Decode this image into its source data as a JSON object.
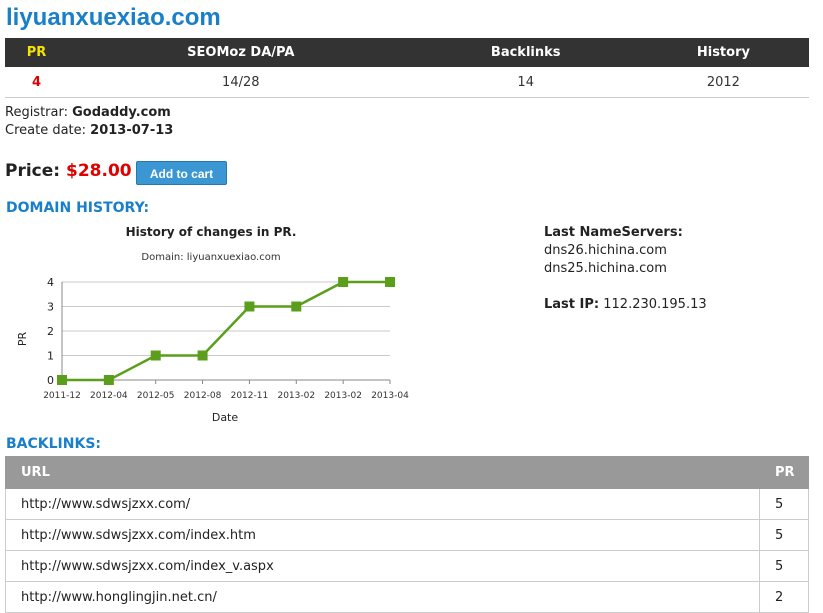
{
  "domain": "liyuanxuexiao.com",
  "stats": {
    "headers": [
      "PR",
      "SEOMoz DA/PA",
      "Backlinks",
      "History"
    ],
    "values": [
      "4",
      "14/28",
      "14",
      "2012"
    ]
  },
  "registrar_label": "Registrar:",
  "registrar": "Godaddy.com",
  "create_label": "Create date:",
  "create_date": "2013-07-13",
  "price_label": "Price:",
  "price": "$28.00",
  "add_to_cart": "Add to cart",
  "history_heading": "DOMAIN HISTORY:",
  "nameservers": {
    "label": "Last NameServers:",
    "servers": [
      "dns26.hichina.com",
      "dns25.hichina.com"
    ],
    "ip_label": "Last IP:",
    "ip": "112.230.195.13"
  },
  "chart_data": {
    "type": "line",
    "title": "History of changes in PR.",
    "subtitle": "Domain: liyuanxuexiao.com",
    "xlabel": "Date",
    "ylabel": "PR",
    "categories": [
      "2011-12",
      "2012-04",
      "2012-05",
      "2012-08",
      "2012-11",
      "2013-02",
      "2013-02",
      "2013-04"
    ],
    "values": [
      0,
      0,
      1,
      1,
      3,
      3,
      4,
      4
    ],
    "ylim": [
      0,
      4
    ],
    "yticks": [
      0,
      1,
      2,
      3,
      4
    ],
    "color": "#5a9e1c",
    "grid": true
  },
  "backlinks_heading": "BACKLINKS:",
  "backlinks": {
    "columns": [
      "URL",
      "PR"
    ],
    "rows": [
      {
        "url": "http://www.sdwsjzxx.com/",
        "pr": "5"
      },
      {
        "url": "http://www.sdwsjzxx.com/index.htm",
        "pr": "5"
      },
      {
        "url": "http://www.sdwsjzxx.com/index_v.aspx",
        "pr": "5"
      },
      {
        "url": "http://www.honglingjin.net.cn/",
        "pr": "2"
      }
    ]
  }
}
